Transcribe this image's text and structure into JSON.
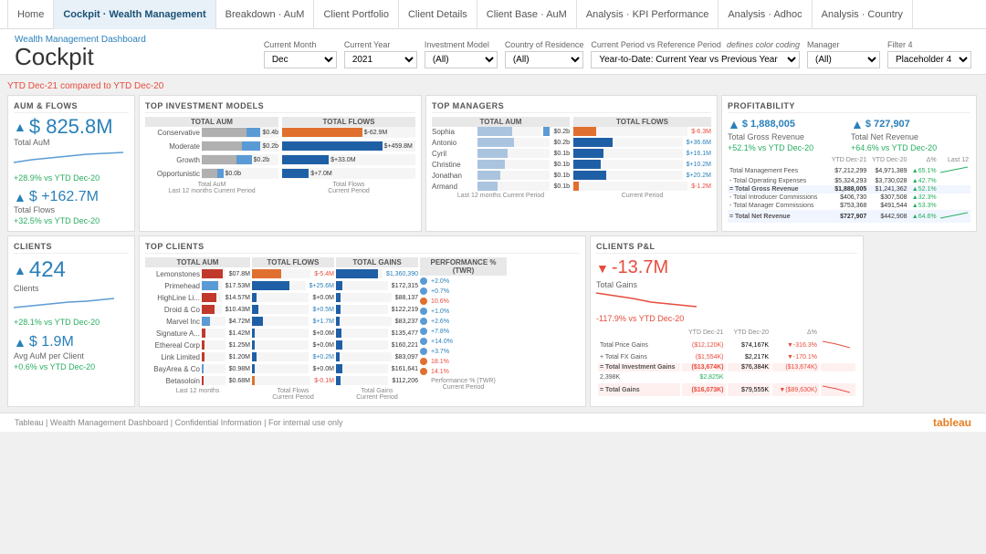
{
  "nav": {
    "items": [
      {
        "label": "Home",
        "active": false
      },
      {
        "label": "Cockpit · Wealth Management",
        "active": true
      },
      {
        "label": "Breakdown · AuM",
        "active": false
      },
      {
        "label": "Client Portfolio",
        "active": false
      },
      {
        "label": "Client Details",
        "active": false
      },
      {
        "label": "Client Base · AuM",
        "active": false
      },
      {
        "label": "Analysis · KPI Performance",
        "active": false
      },
      {
        "label": "Analysis · Adhoc",
        "active": false
      },
      {
        "label": "Analysis · Country",
        "active": false
      }
    ]
  },
  "header": {
    "breadcrumb": "Wealth Management Dashboard",
    "title": "Cockpit",
    "filters": {
      "current_month_label": "Current Month",
      "current_month_value": "Dec",
      "current_year_label": "Current Year",
      "current_year_value": "2021",
      "investment_model_label": "Investment Model",
      "investment_model_value": "(All)",
      "country_label": "Country of Residence",
      "country_value": "(All)",
      "period_label": "Current Period vs Reference Period",
      "period_desc": "defines color coding",
      "period_value": "Year-to-Date: Current Year vs Previous Year",
      "manager_label": "Manager",
      "manager_value": "(All)",
      "filter4_label": "Filter 4",
      "filter4_value": "Placeholder 4"
    }
  },
  "ytd": {
    "label": "YTD Dec-21",
    "comparison": "compared to YTD Dec-20"
  },
  "aum_flows": {
    "title": "AuM & FLOWS",
    "total_aum": "$ 825.8M",
    "total_aum_label": "Total AuM",
    "aum_change": "+28.9% vs YTD Dec-20",
    "total_flows": "$ +162.7M",
    "total_flows_label": "Total Flows",
    "flows_change": "+32.5% vs YTD Dec-20"
  },
  "top_investment_models": {
    "title": "TOP INVESTMENT MODELS",
    "aum_header": "TOTAL AUM",
    "flows_header": "TOTAL FLOWS",
    "models": [
      {
        "name": "Conservative",
        "aum_gray": 70,
        "aum_blue": 30,
        "aum_val": "$0.4b",
        "flow_val": "$-62.9M",
        "flow_pct": 60
      },
      {
        "name": "Moderate",
        "aum_gray": 65,
        "aum_blue": 35,
        "aum_val": "$0.2b",
        "flow_val": "$+459.8M",
        "flow_pct": 75
      },
      {
        "name": "Growth",
        "aum_gray": 55,
        "aum_blue": 30,
        "aum_val": "$0.2b",
        "flow_val": "$+33.0M",
        "flow_pct": 40
      },
      {
        "name": "Opportunistic",
        "aum_gray": 30,
        "aum_blue": 10,
        "aum_val": "$0.0b",
        "flow_val": "$+7.0M",
        "flow_pct": 20
      }
    ],
    "footer_aum": "Total AuM",
    "footer_flows": "Total Flows",
    "footer_period": "Last 12 months Current Period"
  },
  "top_managers": {
    "title": "TOP MANAGERS",
    "aum_header": "TOTAL AUM",
    "flows_header": "TOTAL FLOWS",
    "managers": [
      {
        "name": "Sophia",
        "aum_w": 55,
        "flow_w": 20,
        "flow_val": "$-6.3M"
      },
      {
        "name": "Antonio",
        "aum_w": 50,
        "flow_w": 18,
        "flow_val": "$+36.6M"
      },
      {
        "name": "Cyril",
        "aum_w": 45,
        "flow_w": 14,
        "flow_val": "$+16.1M"
      },
      {
        "name": "Christine",
        "aum_w": 40,
        "flow_w": 14,
        "flow_val": "$+10.2M"
      },
      {
        "name": "Jonathan",
        "aum_w": 35,
        "flow_w": 12,
        "flow_val": "$+20.2M"
      },
      {
        "name": "Armand",
        "aum_w": 30,
        "flow_w": 10,
        "flow_val": "$-1.2M"
      }
    ]
  },
  "profitability": {
    "title": "PROFITABILITY",
    "gross_revenue": "$ 1,888,005",
    "gross_label": "Total Gross Revenue",
    "gross_change": "+52.1% vs YTD Dec-20",
    "net_revenue": "$ 727,907",
    "net_label": "Total Net Revenue",
    "net_change": "+64.6% vs YTD Dec-20",
    "table": {
      "headers": [
        "",
        "YTD Dec-21",
        "YTD Dec-20",
        "Δ%",
        "Last 12"
      ],
      "rows": [
        {
          "label": "Total Management Fees",
          "v1": "$ 7,212,299",
          "v2": "$ 4,971,389",
          "pct": "▲65.1%",
          "pos": true
        },
        {
          "label": "- Total Operating Expenses",
          "v1": "$ 5,324,293",
          "v2": "$ 3,730,028",
          "pct": "▲42.7%",
          "pos": true
        },
        {
          "label": "= Total Gross Revenue",
          "v1": "$ 1,888,005",
          "v2": "$ 1,241,362",
          "pct": "▲52.1%",
          "pos": true
        },
        {
          "label": "- Total Introducer Commissions",
          "v1": "$ 406,730",
          "v2": "$ 307,508",
          "pct": "▲32.3%",
          "pos": true
        },
        {
          "label": "- Total Manager Commissions",
          "v1": "$ 753,368",
          "v2": "$ 491,544",
          "pct": "▲53.3%",
          "pos": true
        },
        {
          "label": "= Total Net Revenue",
          "v1": "$ 727,907",
          "v2": "$ 442,908",
          "pct": "▲64.6%",
          "pos": true
        }
      ]
    }
  },
  "clients": {
    "title": "CLIENTS",
    "count": "424",
    "count_label": "Clients",
    "clients_change": "+28.1% vs YTD Dec-20",
    "avg_aum": "$ 1.9M",
    "avg_aum_label": "Avg AuM per Client",
    "avg_change": "+0.6% vs YTD Dec-20"
  },
  "top_clients": {
    "title": "TOP CLIENTS",
    "aum_header": "TOTAL AUM",
    "flows_header": "TOTAL FLOWS",
    "gains_header": "TOTAL GAINS",
    "perf_header": "PERFORMANCE % (TWR)",
    "clients": [
      {
        "name": "Lemonstones",
        "aum": "$07.8M",
        "flow": "$-5.4M",
        "gain": "$1,360,390",
        "perf": "+2.0%"
      },
      {
        "name": "Primehead",
        "aum": "$17.53M",
        "flow": "$+25.6M",
        "gain": "$172,315",
        "perf": "+0.7%"
      },
      {
        "name": "HighLine Lim...",
        "aum": "$14.57M",
        "flow": "$+0.0M",
        "gain": "$88,137",
        "perf": "10.6%"
      },
      {
        "name": "Droid & Co",
        "aum": "$10.43M",
        "flow": "$+0.5M",
        "gain": "$122,219",
        "perf": "+1.0%"
      },
      {
        "name": "Marvel Inc",
        "aum": "$4.72M",
        "flow": "$+1.7M",
        "gain": "$83,237",
        "perf": "+2.6%"
      },
      {
        "name": "Signature Ac...",
        "aum": "$1.42M",
        "flow": "$+0.0M",
        "gain": "$135,477",
        "perf": "+7.8%"
      },
      {
        "name": "Ethereal Corp",
        "aum": "$1.25M",
        "flow": "$+0.0M",
        "gain": "$160,221",
        "perf": "+14.0%"
      },
      {
        "name": "Link Limited",
        "aum": "$1.20M",
        "flow": "$+0.2M",
        "gain": "$83,097",
        "perf": "+3.7%"
      },
      {
        "name": "BayArea & Co",
        "aum": "$0.98M",
        "flow": "$+0.0M",
        "gain": "$161,641",
        "perf": "18.1%"
      },
      {
        "name": "Betasoloin",
        "aum": "$0.68M",
        "flow": "$-0.1M",
        "gain": "$112,206",
        "perf": "14.1%"
      }
    ]
  },
  "clients_pnl": {
    "title": "CLIENTS P&L",
    "total_gains": "-13.7M",
    "gains_label": "Total Gains",
    "gains_change": "-117.9% vs YTD Dec-20",
    "table": {
      "rows": [
        {
          "label": "Total Price Gains",
          "v1": "($12,120K)",
          "v2": "$74,167K",
          "pct": "▼-316.3%",
          "pos": false
        },
        {
          "label": "+ Total FX Gains",
          "v1": "($1,554K)",
          "v2": "$2,217K",
          "pct": "▼-170.1%",
          "pos": false
        },
        {
          "label": "= Total Investment Gains",
          "v1": "($13,674K)",
          "v2": "$76,384K",
          "pct": "($13,674K)",
          "pos": false
        },
        {
          "label": "2,398K",
          "v1": "$2,825K",
          "v2": "",
          "pct": "",
          "pos": true
        },
        {
          "label": "= Total Gains",
          "v1": "($16,073K)",
          "v2": "$79,555K",
          "pct": "▼($89,630K",
          "pos": false
        }
      ]
    }
  },
  "footer": {
    "text": "Tableau | Wealth Management Dashboard | Confidential Information | For internal use only",
    "logo": "tableau"
  }
}
